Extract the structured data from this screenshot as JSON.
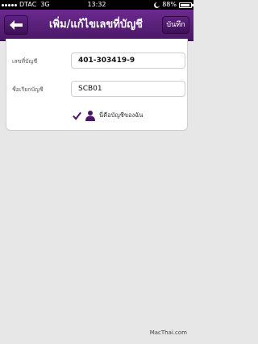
{
  "status_bar": {
    "carrier": "DTAC",
    "network": "3G",
    "time": "13:32",
    "battery_percent": "88%",
    "battery_level": 0.88
  },
  "nav": {
    "title": "เพิ่ม/แก้ไขเลขที่บัญชี",
    "save_label": "บันทึก"
  },
  "form": {
    "account_number_label": "เลขที่บัญชี",
    "account_number_value": "401-303419-9",
    "account_name_label": "ชื่อเรียกบัญชี",
    "account_name_value": "SCB01",
    "own_account_label": "นี่คือบัญชีของฉัน",
    "own_account_checked": true
  },
  "watermark": "MacThai.com",
  "colors": {
    "accent_purple": "#5a1f7a",
    "background": "#e7e7e7"
  }
}
